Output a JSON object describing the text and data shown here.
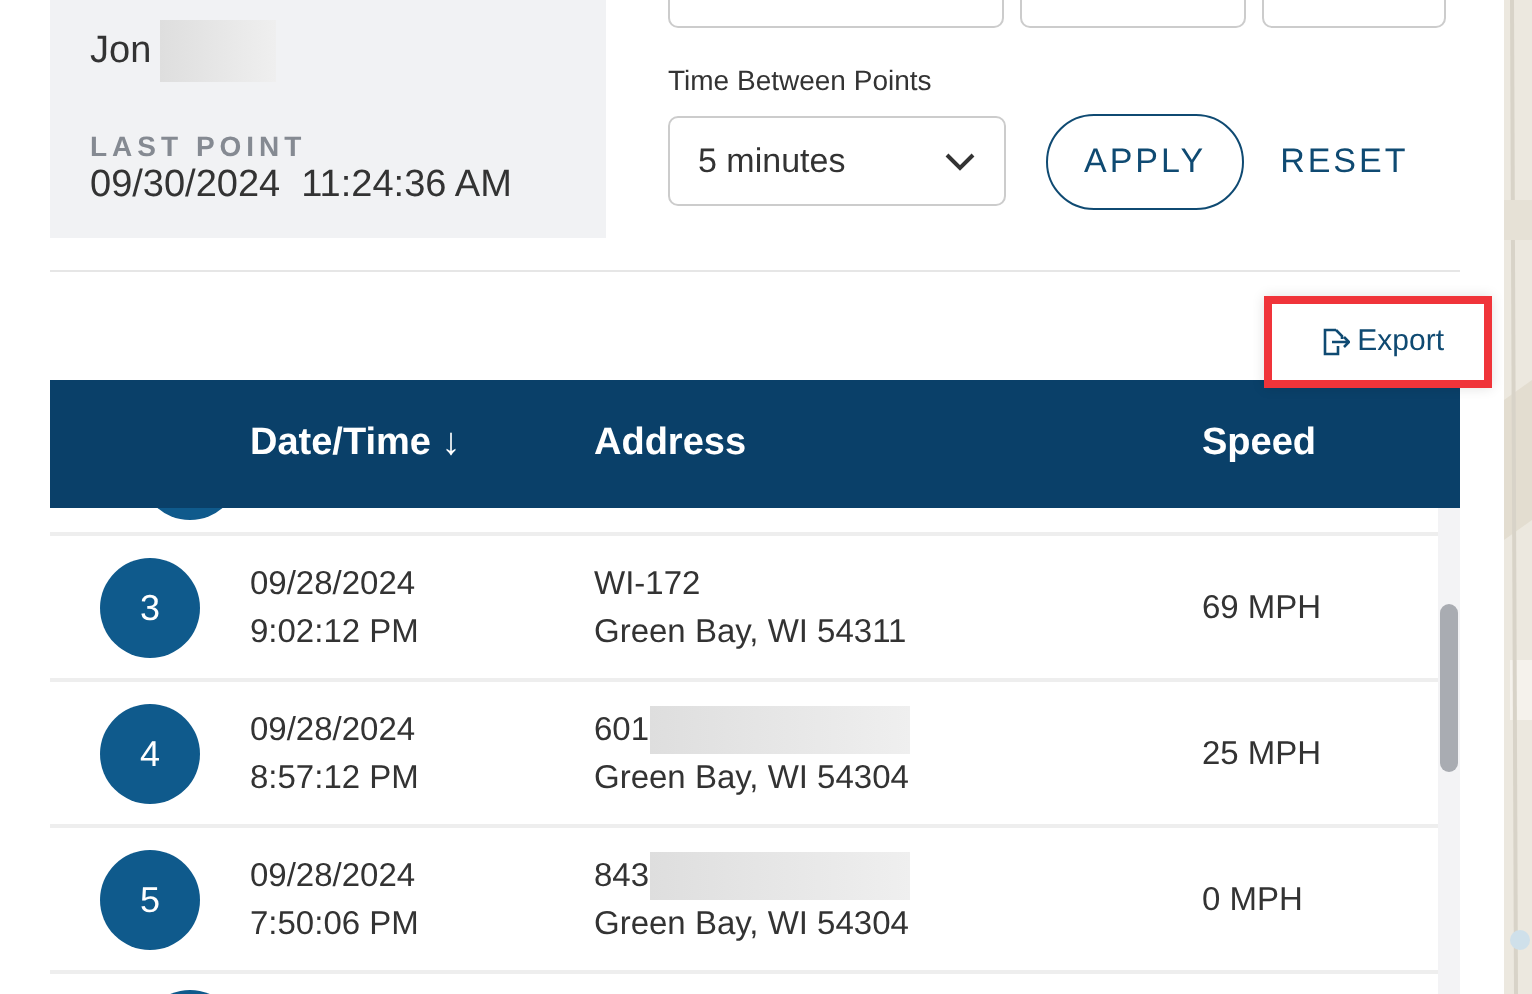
{
  "driver": {
    "name": "Jon"
  },
  "last_point": {
    "label": "LAST POINT",
    "value": "09/30/2024  11:24:36 AM"
  },
  "interval": {
    "label": "Time Between Points",
    "value": "5 minutes"
  },
  "buttons": [
    {
      "label": "APPLY",
      "kind": "outlined"
    },
    {
      "label": "RESET",
      "kind": "text"
    }
  ],
  "export": {
    "label": "Export",
    "highlighted": true
  },
  "table": {
    "columns": [
      {
        "label": "Date/Time ↓"
      },
      {
        "label": "Address"
      },
      {
        "label": "Speed"
      }
    ],
    "rows": [
      {
        "number": "3",
        "date": "09/28/2024",
        "time": "9:02:12 PM",
        "street": "WI-172",
        "redacted": false,
        "city": "Green Bay, WI 54311",
        "speed": "69 MPH"
      },
      {
        "number": "4",
        "date": "09/28/2024",
        "time": "8:57:12 PM",
        "street": "601",
        "redacted": true,
        "city": "Green Bay, WI 54304",
        "speed": "25 MPH"
      },
      {
        "number": "5",
        "date": "09/28/2024",
        "time": "7:50:06 PM",
        "street": "843",
        "redacted": true,
        "city": "Green Bay, WI 54304",
        "speed": "0 MPH"
      }
    ]
  }
}
